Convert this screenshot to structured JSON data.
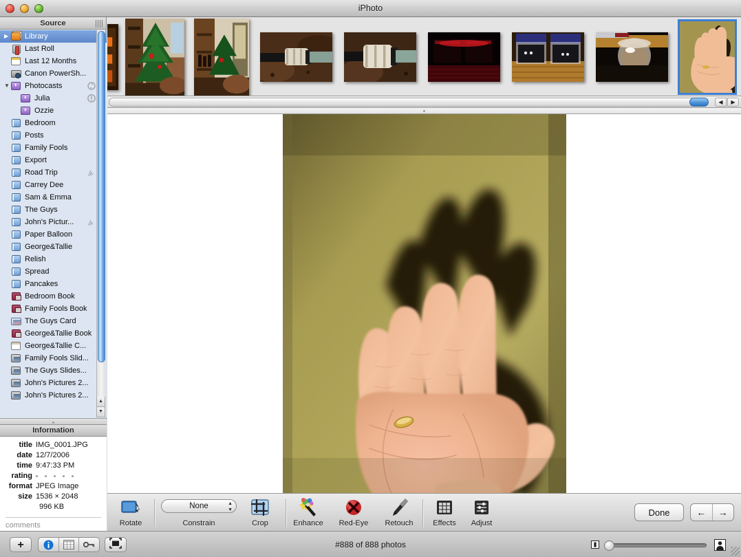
{
  "window": {
    "title": "iPhoto",
    "buttons": {
      "close": "close",
      "minimize": "minimize",
      "zoom": "zoom"
    }
  },
  "sidebar": {
    "header": "Source",
    "items": [
      {
        "label": "Library",
        "icon": "library-icon",
        "indent": 0,
        "selected": true,
        "disclosure": "collapsed",
        "badge": ""
      },
      {
        "label": "Last Roll",
        "icon": "roll-icon",
        "indent": 0,
        "selected": false,
        "disclosure": "",
        "badge": ""
      },
      {
        "label": "Last 12 Months",
        "icon": "calendar-icon",
        "indent": 0,
        "selected": false,
        "disclosure": "",
        "badge": ""
      },
      {
        "label": "Canon PowerSh...",
        "icon": "camera-icon",
        "indent": 0,
        "selected": false,
        "disclosure": "",
        "badge": ""
      },
      {
        "label": "Photocasts",
        "icon": "photocast-icon",
        "indent": 0,
        "selected": false,
        "disclosure": "expanded",
        "badge": "sync-icon"
      },
      {
        "label": "Julia",
        "icon": "photocast-icon",
        "indent": 1,
        "selected": false,
        "disclosure": "",
        "badge": "warning-icon"
      },
      {
        "label": "Ozzie",
        "icon": "photocast-icon",
        "indent": 1,
        "selected": false,
        "disclosure": "",
        "badge": ""
      },
      {
        "label": "Bedroom",
        "icon": "album-icon",
        "indent": 0,
        "selected": false,
        "disclosure": "",
        "badge": ""
      },
      {
        "label": "Posts",
        "icon": "album-icon",
        "indent": 0,
        "selected": false,
        "disclosure": "",
        "badge": ""
      },
      {
        "label": "Family Fools",
        "icon": "album-icon",
        "indent": 0,
        "selected": false,
        "disclosure": "",
        "badge": ""
      },
      {
        "label": "Export",
        "icon": "album-icon",
        "indent": 0,
        "selected": false,
        "disclosure": "",
        "badge": ""
      },
      {
        "label": "Road Trip",
        "icon": "album-icon",
        "indent": 0,
        "selected": false,
        "disclosure": "",
        "badge": "broadcast-icon"
      },
      {
        "label": "Carrey Dee",
        "icon": "album-icon",
        "indent": 0,
        "selected": false,
        "disclosure": "",
        "badge": ""
      },
      {
        "label": "Sam & Emma",
        "icon": "album-icon",
        "indent": 0,
        "selected": false,
        "disclosure": "",
        "badge": ""
      },
      {
        "label": "The Guys",
        "icon": "album-icon",
        "indent": 0,
        "selected": false,
        "disclosure": "",
        "badge": ""
      },
      {
        "label": "John's Pictur...",
        "icon": "album-icon",
        "indent": 0,
        "selected": false,
        "disclosure": "",
        "badge": "broadcast-icon"
      },
      {
        "label": "Paper Balloon",
        "icon": "album-icon",
        "indent": 0,
        "selected": false,
        "disclosure": "",
        "badge": ""
      },
      {
        "label": "George&Tallie",
        "icon": "album-icon",
        "indent": 0,
        "selected": false,
        "disclosure": "",
        "badge": ""
      },
      {
        "label": "Relish",
        "icon": "album-icon",
        "indent": 0,
        "selected": false,
        "disclosure": "",
        "badge": ""
      },
      {
        "label": "Spread",
        "icon": "album-icon",
        "indent": 0,
        "selected": false,
        "disclosure": "",
        "badge": ""
      },
      {
        "label": "Pancakes",
        "icon": "album-icon",
        "indent": 0,
        "selected": false,
        "disclosure": "",
        "badge": ""
      },
      {
        "label": "Bedroom Book",
        "icon": "book-icon",
        "indent": 0,
        "selected": false,
        "disclosure": "",
        "badge": ""
      },
      {
        "label": "Family Fools Book",
        "icon": "book-icon",
        "indent": 0,
        "selected": false,
        "disclosure": "",
        "badge": ""
      },
      {
        "label": "The Guys Card",
        "icon": "card-icon",
        "indent": 0,
        "selected": false,
        "disclosure": "",
        "badge": ""
      },
      {
        "label": "George&Tallie Book",
        "icon": "book-icon",
        "indent": 0,
        "selected": false,
        "disclosure": "",
        "badge": ""
      },
      {
        "label": "George&Tallie C...",
        "icon": "calendar2-icon",
        "indent": 0,
        "selected": false,
        "disclosure": "",
        "badge": ""
      },
      {
        "label": "Family Fools Slid...",
        "icon": "slideshow-icon",
        "indent": 0,
        "selected": false,
        "disclosure": "",
        "badge": ""
      },
      {
        "label": "The Guys Slides...",
        "icon": "slideshow-icon",
        "indent": 0,
        "selected": false,
        "disclosure": "",
        "badge": ""
      },
      {
        "label": "John's Pictures 2...",
        "icon": "slideshow-icon",
        "indent": 0,
        "selected": false,
        "disclosure": "",
        "badge": ""
      },
      {
        "label": "John's Pictures 2...",
        "icon": "slideshow-icon",
        "indent": 0,
        "selected": false,
        "disclosure": "",
        "badge": ""
      }
    ]
  },
  "information": {
    "header": "Information",
    "fields": [
      {
        "key": "title",
        "value": "IMG_0001.JPG"
      },
      {
        "key": "date",
        "value": "12/7/2006"
      },
      {
        "key": "time",
        "value": "9:47:33 PM"
      },
      {
        "key": "rating",
        "value": ""
      },
      {
        "key": "format",
        "value": "JPEG Image"
      },
      {
        "key": "size",
        "value": "1536 × 2048"
      }
    ],
    "rating_stars": 5,
    "rating_filled": 0,
    "filesize": "996 KB",
    "comments_placeholder": "comments"
  },
  "filmstrip": {
    "thumbnails": [
      {
        "name": "thumbnail-orange-shelf",
        "selected": false
      },
      {
        "name": "thumbnail-christmas-tree",
        "selected": false
      },
      {
        "name": "thumbnail-tree-doorway",
        "selected": false
      },
      {
        "name": "thumbnail-pipe-fitting-1",
        "selected": false
      },
      {
        "name": "thumbnail-pipe-fitting-2",
        "selected": false
      },
      {
        "name": "thumbnail-red-dark",
        "selected": false
      },
      {
        "name": "thumbnail-black-foam-cases",
        "selected": false
      },
      {
        "name": "thumbnail-glass-jar",
        "selected": false
      },
      {
        "name": "thumbnail-open-hand",
        "selected": true
      }
    ]
  },
  "photo": {
    "name": "open-hand-photo"
  },
  "toolbar": {
    "rotate_label": "Rotate",
    "constrain_label": "Constrain",
    "constrain_value": "None",
    "crop_label": "Crop",
    "enhance_label": "Enhance",
    "redeye_label": "Red-Eye",
    "retouch_label": "Retouch",
    "effects_label": "Effects",
    "adjust_label": "Adjust",
    "done_label": "Done",
    "prev_label": "←",
    "next_label": "→"
  },
  "statusbar": {
    "add_label": "+",
    "info_label": "i",
    "count_text": "#888 of 888 photos"
  },
  "colors": {
    "selection_blue": "#5d87c9",
    "sidebar_bg": "#dce5f1",
    "accent_blue": "#3b7fd4"
  }
}
